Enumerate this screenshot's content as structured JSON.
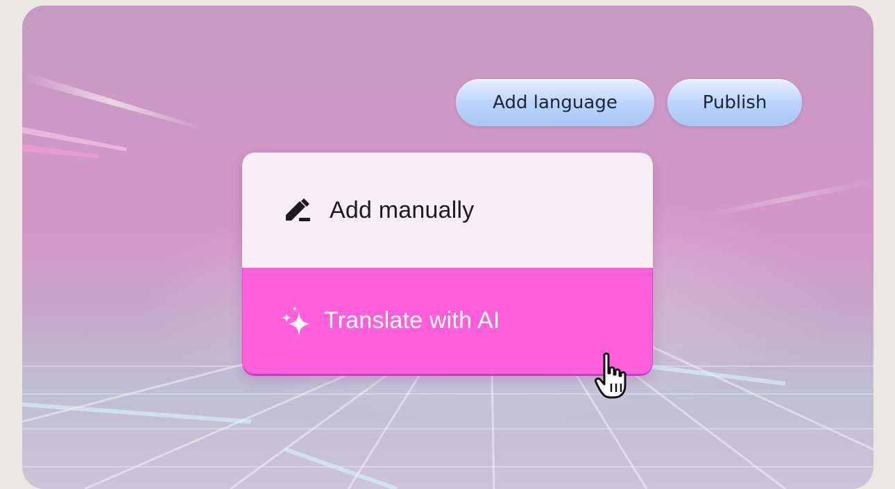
{
  "toolbar": {
    "add_language_label": "Add language",
    "publish_label": "Publish"
  },
  "menu": {
    "items": [
      {
        "label": "Add manually",
        "icon": "pencil-icon"
      },
      {
        "label": "Translate with AI",
        "icon": "sparkle-icon",
        "state": "hovered"
      }
    ]
  },
  "colors": {
    "page_background": "#ebe8e1",
    "pill_button": "#b8d2fb",
    "menu_item_default": "#f5eef4",
    "menu_item_highlight": "#ff5fda"
  },
  "pointer": {
    "type": "hand-pointer-icon"
  }
}
